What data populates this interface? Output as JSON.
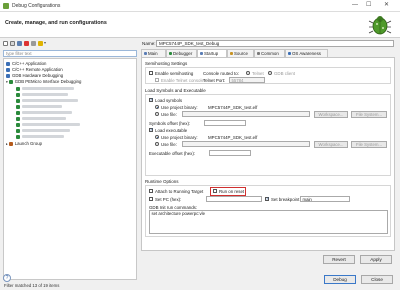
{
  "window": {
    "title": "Debug Configurations",
    "controls": {
      "minimize": "—",
      "maximize": "☐",
      "close": "✕"
    }
  },
  "header": {
    "title": "Create, manage, and run configurations",
    "logo_icon": "debug-bug-icon"
  },
  "left_panel": {
    "filter_placeholder": "type filter text",
    "tree": [
      {
        "label": "C/C++ Application",
        "icon": "c-app-icon",
        "color": "#3b6fb6"
      },
      {
        "label": "C/C++ Remote Application",
        "icon": "c-remote-icon",
        "color": "#3b6fb6"
      },
      {
        "label": "GDB Hardware Debugging",
        "icon": "gdb-hw-icon",
        "color": "#3b6fb6"
      },
      {
        "label": "GDB PEMicro Interface Debugging",
        "icon": "pemicro-icon",
        "color": "#2a8a3b"
      },
      {
        "label": "Launch Group",
        "icon": "launch-group-icon",
        "color": "#b55b1c"
      }
    ],
    "filter_message": "Filter matched 13 of 19 items"
  },
  "config": {
    "name_label": "Name:",
    "name_value": "MPC5744P_SDK_test_Debug",
    "tabs": [
      {
        "label": "Main",
        "color": "#5a7db5"
      },
      {
        "label": "Debugger",
        "color": "#2a8a3b"
      },
      {
        "label": "Startup",
        "color": "#5a7db5"
      },
      {
        "label": "Source",
        "color": "#c89323"
      },
      {
        "label": "Common",
        "color": "#7a7a7a"
      },
      {
        "label": "OS Awareness",
        "color": "#3b6fb6"
      }
    ],
    "semihosting": {
      "title": "Semihosting Settings",
      "enable_semihosting": "Enable semihosting",
      "console_routed": "Console routed to:",
      "telnet": "Telnet",
      "gdb_client": "GDB client",
      "enable_telnet": "Enable Telnet console",
      "telnet_port_label": "Telnet Port:",
      "telnet_port": "55784"
    },
    "load": {
      "title": "Load Symbols and Executable",
      "load_symbols": "Load symbols",
      "use_project_binary": "Use project binary:",
      "symbols_binary": "MPC5744P_SDK_test.elf",
      "use_file": "Use file:",
      "workspace": "Workspace...",
      "file_system": "File System...",
      "symbols_offset": "Symbols offset (hex):",
      "load_executable": "Load executable",
      "exec_binary": "MPC5744P_SDK_test.elf",
      "executable_offset": "Executable offset (hex):"
    },
    "runtime": {
      "title": "Runtime Options",
      "attach": "Attach to Running Target",
      "run_on_reset": "Run on reset",
      "set_pc": "Set PC (hex):",
      "set_breakpoint": "Set breakpoint at:",
      "breakpoint_value": "main",
      "gdb_commands_label": "GDB Init run commands:",
      "gdb_commands": "set architecture powerpc:vle"
    },
    "buttons": {
      "revert": "Revert",
      "apply": "Apply"
    }
  },
  "footer": {
    "help": "?",
    "debug": "Debug",
    "close": "Close"
  }
}
